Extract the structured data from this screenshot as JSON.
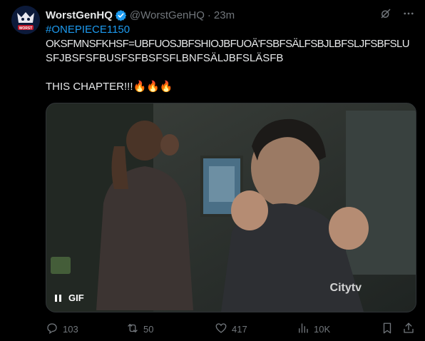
{
  "tweet": {
    "author_name": "WorstGenHQ",
    "handle": "@WorstGenHQ",
    "separator": "·",
    "time": "23m",
    "hashtag": "#ONEPIECE1150",
    "line1": "OKSFMNSFKHSF=UBFUOSJBFSHIOJBFUOÄ'FSBFSÄLFSBJLBFSLJFSBFSLU",
    "line2": "SFJBSFSFBUSFSFBSFSFLBNFSÄLJBFSLÄSFB",
    "line3": "THIS CHAPTER!!!🔥🔥🔥",
    "avatar_text": "WORST GEN"
  },
  "media": {
    "pause_icon": "pause-icon",
    "gif_label": "GIF",
    "watermark": "Citytv"
  },
  "actions": {
    "reply_count": "103",
    "retweet_count": "50",
    "like_count": "417",
    "views_count": "10K"
  },
  "colors": {
    "background": "#000000",
    "text": "#e7e9ea",
    "muted": "#71767b",
    "accent": "#1d9bf0"
  }
}
